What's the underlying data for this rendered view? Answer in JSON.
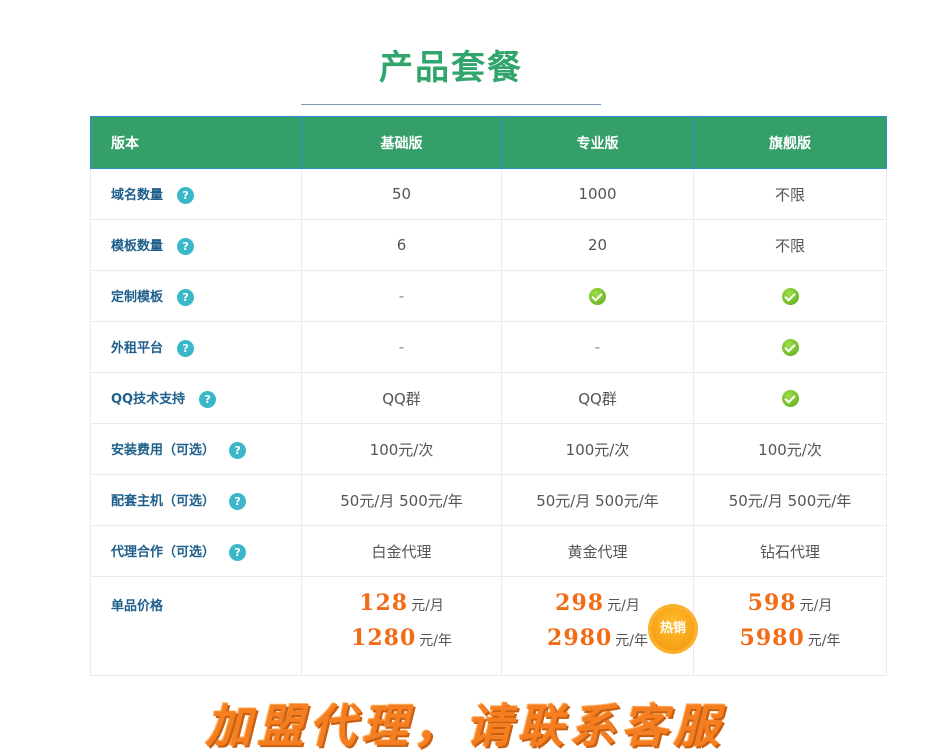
{
  "title": "产品套餐",
  "table": {
    "headers": [
      "版本",
      "基础版",
      "专业版",
      "旗舰版"
    ],
    "help_icon": "?",
    "rows": [
      {
        "feature": "域名数量",
        "values": [
          "50",
          "1000",
          "不限"
        ]
      },
      {
        "feature": "模板数量",
        "values": [
          "6",
          "20",
          "不限"
        ]
      },
      {
        "feature": "定制模板",
        "values": [
          "-",
          "check",
          "check"
        ]
      },
      {
        "feature": "外租平台",
        "values": [
          "-",
          "-",
          "check"
        ]
      },
      {
        "feature": "QQ技术支持",
        "values": [
          "QQ群",
          "QQ群",
          "check"
        ]
      },
      {
        "feature": "安装费用（可选）",
        "values": [
          "100元/次",
          "100元/次",
          "100元/次"
        ]
      },
      {
        "feature": "配套主机（可选）",
        "values": [
          "50元/月 500元/年",
          "50元/月 500元/年",
          "50元/月 500元/年"
        ]
      },
      {
        "feature": "代理合作（可选）",
        "values": [
          "白金代理",
          "黄金代理",
          "钻石代理"
        ]
      }
    ],
    "price_row": {
      "feature": "单品价格",
      "plans": [
        {
          "monthly": "128",
          "monthly_unit": "元/月",
          "yearly": "1280",
          "yearly_unit": "元/年"
        },
        {
          "monthly": "298",
          "monthly_unit": "元/月",
          "yearly": "2980",
          "yearly_unit": "元/年",
          "badge": "热销"
        },
        {
          "monthly": "598",
          "monthly_unit": "元/月",
          "yearly": "5980",
          "yearly_unit": "元/年"
        }
      ]
    }
  },
  "banner": "加盟代理，请联系客服",
  "colors": {
    "title": "#32a56d",
    "header_bg": "#359f6a",
    "price": "#f26b17",
    "banner": "#f57f20",
    "feature_text": "#1f5f8b"
  },
  "icons": {
    "help": "question-circle-icon",
    "check": "check-circle-icon",
    "hot": "hot-sale-badge"
  }
}
